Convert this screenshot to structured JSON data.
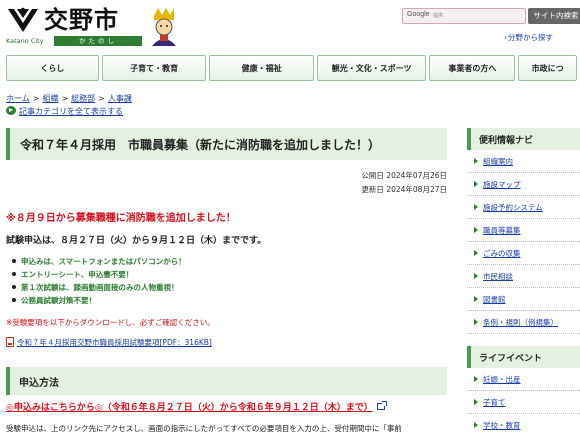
{
  "header": {
    "logo_text": "交野市",
    "logo_en": "Katano City",
    "logo_kana": "かたのし",
    "search_engine": "Google",
    "search_placeholder": "提供",
    "search_button": "サイト内検索",
    "sitemap_link": "分野から探す"
  },
  "gnav": [
    {
      "label": "くらし",
      "w": 95
    },
    {
      "label": "子育て・教育",
      "w": 107
    },
    {
      "label": "健康・福祉",
      "w": 107
    },
    {
      "label": "観光・文化・スポーツ",
      "w": 112
    },
    {
      "label": "事業者の方へ",
      "w": 88
    },
    {
      "label": "市政につ",
      "w": 60
    }
  ],
  "breadcrumb": {
    "items": [
      "ホーム",
      "組織",
      "総務部",
      "人事課"
    ],
    "separator": ">"
  },
  "category_link": "記事カテゴリを全て表示する",
  "page": {
    "title": "令和７年４月採用　市職員募集（新たに消防職を追加しました！）",
    "published": "公開日 2024年07月26日",
    "updated": "更新日 2024年08月27日",
    "notice": "※８月９日から募集職種に消防職を追加しました！",
    "period": "試験申込は、８月２７日（火）から９月１２日（木）までです。",
    "bullets": [
      "申込みは、スマートフォンまたはパソコンから！",
      "エントリーシート、申込書不要！",
      "第１次試験は、録画動画面接のみの人物重視！",
      "公務員試験対策不要！"
    ],
    "download_note": "※受験要項を以下からダウンロードし、必ずご確認ください。",
    "pdf_link": "令和７年４月採用交野市職員採用試験要項[PDF：316KB]",
    "section_title": "申込方法",
    "apply_link": "◎申込みはこちらから◎（令和６年８月２７日（火）から令和６年９月１２日（木）まで）",
    "body_text": "受験申込は、上のリンク先にアクセスし、画面の指示にしたがってすべての必要項目を入力の上、受付期間中に「事前"
  },
  "sidebar": {
    "nav_title": "便利情報ナビ",
    "nav_items": [
      "組織案内",
      "施設マップ",
      "施設予約システム",
      "職員等募集",
      "ごみの収集",
      "市民相談",
      "図書館",
      "条例・規則（例規集）"
    ],
    "life_title": "ライフイベント",
    "life_items": [
      "妊娠・出産",
      "子育て",
      "学校・教育"
    ]
  },
  "colors": {
    "accent_green": "#4a9a52",
    "alert_red": "#d4111e",
    "link_blue": "#1a3fa8"
  }
}
